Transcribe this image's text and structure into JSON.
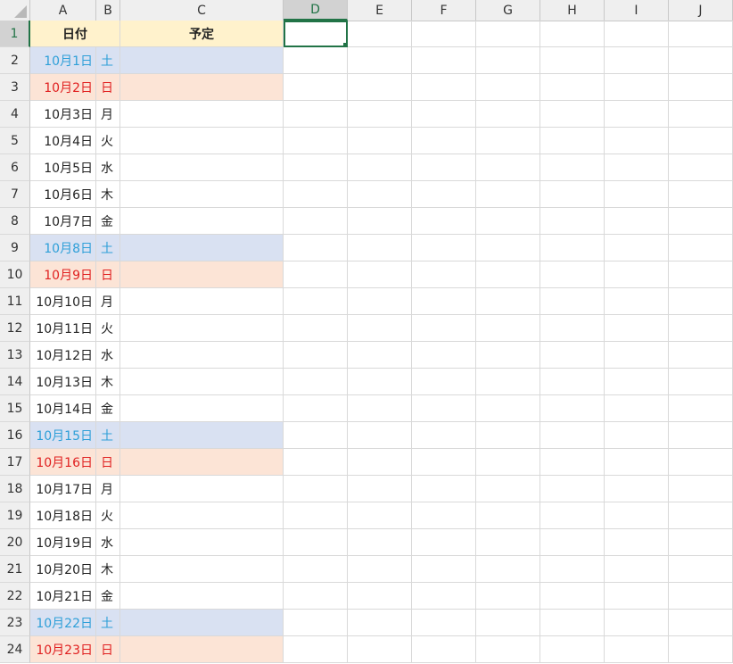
{
  "columns": [
    "A",
    "B",
    "C",
    "D",
    "E",
    "F",
    "G",
    "H",
    "I",
    "J"
  ],
  "selected_column": "D",
  "header": {
    "date": "日付",
    "plan": "予定"
  },
  "rows": [
    {
      "num": "1"
    },
    {
      "num": "2",
      "date": "10月1日",
      "wd": "土",
      "type": "sat"
    },
    {
      "num": "3",
      "date": "10月2日",
      "wd": "日",
      "type": "sun"
    },
    {
      "num": "4",
      "date": "10月3日",
      "wd": "月",
      "type": ""
    },
    {
      "num": "5",
      "date": "10月4日",
      "wd": "火",
      "type": ""
    },
    {
      "num": "6",
      "date": "10月5日",
      "wd": "水",
      "type": ""
    },
    {
      "num": "7",
      "date": "10月6日",
      "wd": "木",
      "type": ""
    },
    {
      "num": "8",
      "date": "10月7日",
      "wd": "金",
      "type": ""
    },
    {
      "num": "9",
      "date": "10月8日",
      "wd": "土",
      "type": "sat"
    },
    {
      "num": "10",
      "date": "10月9日",
      "wd": "日",
      "type": "sun"
    },
    {
      "num": "11",
      "date": "10月10日",
      "wd": "月",
      "type": ""
    },
    {
      "num": "12",
      "date": "10月11日",
      "wd": "火",
      "type": ""
    },
    {
      "num": "13",
      "date": "10月12日",
      "wd": "水",
      "type": ""
    },
    {
      "num": "14",
      "date": "10月13日",
      "wd": "木",
      "type": ""
    },
    {
      "num": "15",
      "date": "10月14日",
      "wd": "金",
      "type": ""
    },
    {
      "num": "16",
      "date": "10月15日",
      "wd": "土",
      "type": "sat"
    },
    {
      "num": "17",
      "date": "10月16日",
      "wd": "日",
      "type": "sun"
    },
    {
      "num": "18",
      "date": "10月17日",
      "wd": "月",
      "type": ""
    },
    {
      "num": "19",
      "date": "10月18日",
      "wd": "火",
      "type": ""
    },
    {
      "num": "20",
      "date": "10月19日",
      "wd": "水",
      "type": ""
    },
    {
      "num": "21",
      "date": "10月20日",
      "wd": "木",
      "type": ""
    },
    {
      "num": "22",
      "date": "10月21日",
      "wd": "金",
      "type": ""
    },
    {
      "num": "23",
      "date": "10月22日",
      "wd": "土",
      "type": "sat"
    },
    {
      "num": "24",
      "date": "10月23日",
      "wd": "日",
      "type": "sun"
    }
  ],
  "colors": {
    "saturday_text": "#2e9fd8",
    "saturday_fill": "#d9e1f2",
    "sunday_text": "#e02020",
    "sunday_fill": "#fce4d6",
    "header_fill": "#fff2cc",
    "selection": "#217346"
  }
}
